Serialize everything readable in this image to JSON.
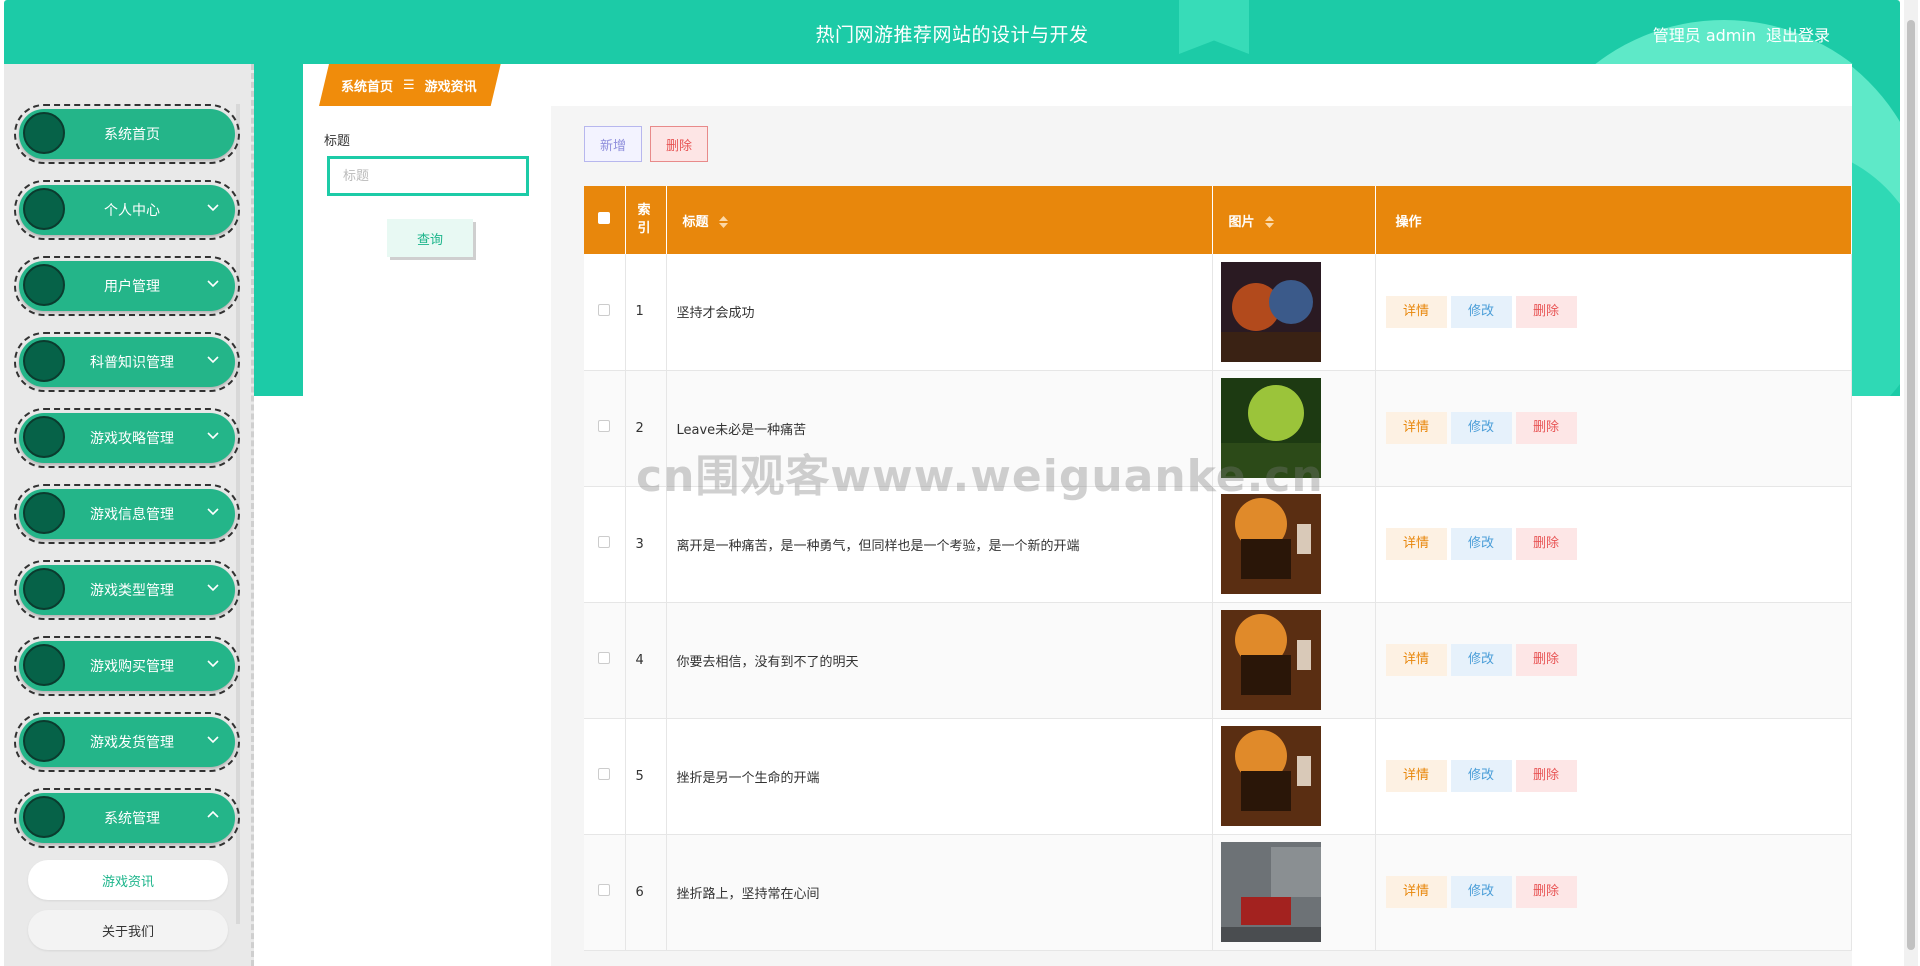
{
  "header": {
    "title": "热门网游推荐网站的设计与开发",
    "user_label": "管理员 admin",
    "logout_label": "退出登录"
  },
  "sidebar": {
    "items": [
      {
        "label": "系统首页",
        "chevron": ""
      },
      {
        "label": "个人中心",
        "chevron": "down"
      },
      {
        "label": "用户管理",
        "chevron": "down"
      },
      {
        "label": "科普知识管理",
        "chevron": "down"
      },
      {
        "label": "游戏攻略管理",
        "chevron": "down"
      },
      {
        "label": "游戏信息管理",
        "chevron": "down"
      },
      {
        "label": "游戏类型管理",
        "chevron": "down"
      },
      {
        "label": "游戏购买管理",
        "chevron": "down"
      },
      {
        "label": "游戏发货管理",
        "chevron": "down"
      },
      {
        "label": "系统管理",
        "chevron": "up"
      }
    ],
    "sub_items": [
      {
        "label": "游戏资讯",
        "active": true
      },
      {
        "label": "关于我们",
        "active": false
      }
    ]
  },
  "breadcrumb": {
    "home": "系统首页",
    "separator": "☰",
    "current": "游戏资讯"
  },
  "search": {
    "label": "标题",
    "placeholder": "标题",
    "button": "查询"
  },
  "actions": {
    "add": "新增",
    "delete": "删除"
  },
  "table": {
    "columns": {
      "index": "索引",
      "title": "标题",
      "image": "图片",
      "ops": "操作"
    },
    "row_actions": {
      "detail": "详情",
      "edit": "修改",
      "delete": "删除"
    },
    "rows": [
      {
        "index": "1",
        "title": "坚持才会成功",
        "image": "fantasy-battle"
      },
      {
        "index": "2",
        "title": "Leave未必是一种痛苦",
        "image": "forest-scene"
      },
      {
        "index": "3",
        "title": "离开是一种痛苦，是一种勇气，但同样也是一个考验，是一个新的开端",
        "image": "sunset-rider"
      },
      {
        "index": "4",
        "title": "你要去相信，没有到不了的明天",
        "image": "sunset-rider"
      },
      {
        "index": "5",
        "title": "挫折是另一个生命的开端",
        "image": "sunset-rider"
      },
      {
        "index": "6",
        "title": "挫折路上，坚持常在心间",
        "image": "street-car"
      }
    ]
  },
  "watermark": "cn围观客www.weiguanke.cn",
  "colors": {
    "brand": "#1ccba7",
    "sidebar_pill": "#24b589",
    "table_header": "#e8870c"
  }
}
